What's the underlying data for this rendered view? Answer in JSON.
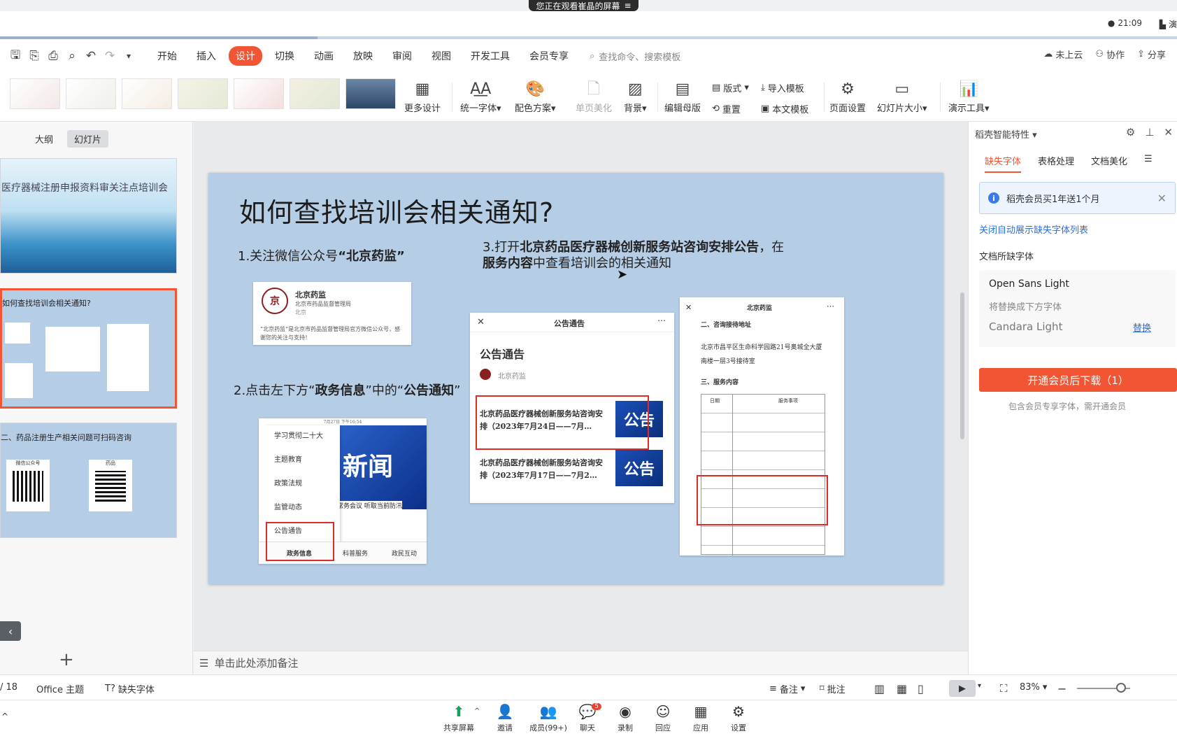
{
  "share_banner": "您正在观看崔晶的屏幕",
  "clock": "21:09",
  "present_mini": "演",
  "menu": {
    "tabs": [
      "开始",
      "插入",
      "设计",
      "切换",
      "动画",
      "放映",
      "审阅",
      "视图",
      "开发工具",
      "会员专享"
    ],
    "active": "设计",
    "search_placeholder": "查找命令、搜索模板",
    "right": [
      "未上云",
      "协作",
      "分享"
    ]
  },
  "ribbon": {
    "more_design": "更多设计",
    "unify_font": "统一字体",
    "color_scheme": "配色方案",
    "single_beautify": "单页美化",
    "background": "背景",
    "edit_master": "编辑母版",
    "layout": "版式",
    "reset": "重置",
    "import_template": "导入模板",
    "text_template": "本文模板",
    "page_setup": "页面设置",
    "slide_size": "幻灯片大小",
    "present_tools": "演示工具"
  },
  "left_pane": {
    "tabs": [
      "大纲",
      "幻灯片"
    ],
    "selected_tab": "幻灯片",
    "thumb1_text": "医疗器械注册申报资料审关注点培训会",
    "thumb2_text": "如何查找培训会相关通知?",
    "thumb3_text": "二、药品注册生产相关问题可扫码咨询",
    "thumb3_qr_labels": [
      "微信公众号",
      "药品"
    ]
  },
  "slide": {
    "title": "如何查找培训会相关通知?",
    "step1_prefix": "1.关注微信公众号",
    "step1_bold": "“北京药监”",
    "step2_prefix": "2.点击左下方“",
    "step2_bold1": "政务信息",
    "step2_mid": "”中的“",
    "step2_bold2": "公告通知",
    "step2_suffix": "”",
    "step3_prefix": "3.打开",
    "step3_bold": "北京药品医疗器械创新服务站咨询安排公告",
    "step3_mid": "，在",
    "step3_bold2": "服务内容",
    "step3_suffix": "中查看培训会的相关通知",
    "wechat_card": {
      "name": "北京药监",
      "desc": "北京市药品监督管理局",
      "region": "北京",
      "intro": "“北京药监”是北京市药品监督管理局官方微信公众号，感谢您的关注与支持！"
    },
    "menu_shot": {
      "status": "7月27日 下午16:54",
      "items": [
        "学习贯彻二十大",
        "主题教育",
        "政策法规",
        "监管动态",
        "公告通告"
      ],
      "bottom": [
        "政务信息",
        "科普服务",
        "政民互动"
      ],
      "banner_text": "新闻",
      "caption": "常务会议 听取当前防汛"
    },
    "notice_shot": {
      "header": "公告通告",
      "heading": "公告通告",
      "source": "北京药监",
      "items": [
        "北京药品医疗器械创新服务站咨询安排（2023年7月24日——7月…",
        "北京药品医疗器械创新服务站咨询安排（2023年7月17日——7月2…"
      ],
      "badge": "公告"
    },
    "doc_shot": {
      "header": "北京药监",
      "section2": "二、咨询接待地址",
      "address": "北京市昌平区生命科学园路21号奥城全大厦南楼一层3号接待室",
      "section3": "三、服务内容",
      "table_headers": [
        "日期",
        "服务事项"
      ]
    }
  },
  "notes_placeholder": "单击此处添加备注",
  "right_panel": {
    "title": "稻壳智能特性",
    "tabs": [
      "缺失字体",
      "表格处理",
      "文档美化"
    ],
    "selected_tab": "缺失字体",
    "promo": "稻壳会员买1年送1个月",
    "close_auto": "关闭自动展示缺失字体列表",
    "missing_title": "文档所缺字体",
    "original_font": "Open Sans Light",
    "will_replace": "将替换成下方字体",
    "new_font": "Candara Light",
    "replace_link": "替换",
    "download_btn": "开通会员后下载（1）",
    "download_sub": "包含会员专享字体，需开通会员"
  },
  "status": {
    "page": "/ 18",
    "theme": "Office 主题",
    "missing_font": "缺失字体",
    "notes": "备注",
    "comments": "批注",
    "zoom": "83%"
  },
  "meeting": {
    "items": [
      "共享屏幕",
      "邀请",
      "成员(99+)",
      "聊天",
      "录制",
      "回应",
      "应用",
      "设置"
    ],
    "chat_badge": "5"
  },
  "colors": {
    "accent": "#f25533",
    "slide_bg": "#b6cde6",
    "link": "#2f6fd6"
  }
}
